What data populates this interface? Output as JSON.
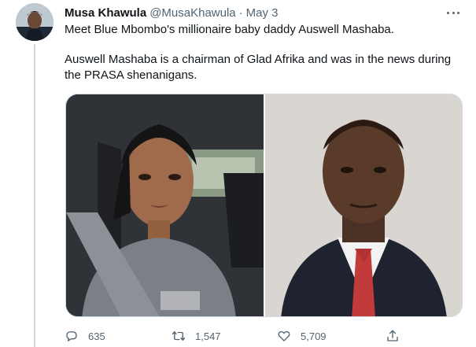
{
  "tweet": {
    "author_name": "Musa Khawula",
    "author_handle": "@MusaKhawula",
    "separator": "·",
    "date": "May 3",
    "text_line1": "Meet Blue Mbombo's millionaire baby daddy Auswell Mashaba.",
    "text_line2": "Auswell Mashaba is a chairman of Glad Afrika and was in the news during",
    "text_line3": "the PRASA shenanigans.",
    "photo_right_caption": "",
    "stats": {
      "replies": "635",
      "retweets": "1,547",
      "likes": "5,709"
    }
  },
  "icons": {
    "more": "more-horizontal-icon",
    "reply": "reply-bubble-icon",
    "retweet": "retweet-icon",
    "like": "heart-icon",
    "share": "share-upload-icon"
  },
  "colors": {
    "secondary_text": "#536471",
    "border": "#cfd9de",
    "primary_text": "#0f1419"
  }
}
